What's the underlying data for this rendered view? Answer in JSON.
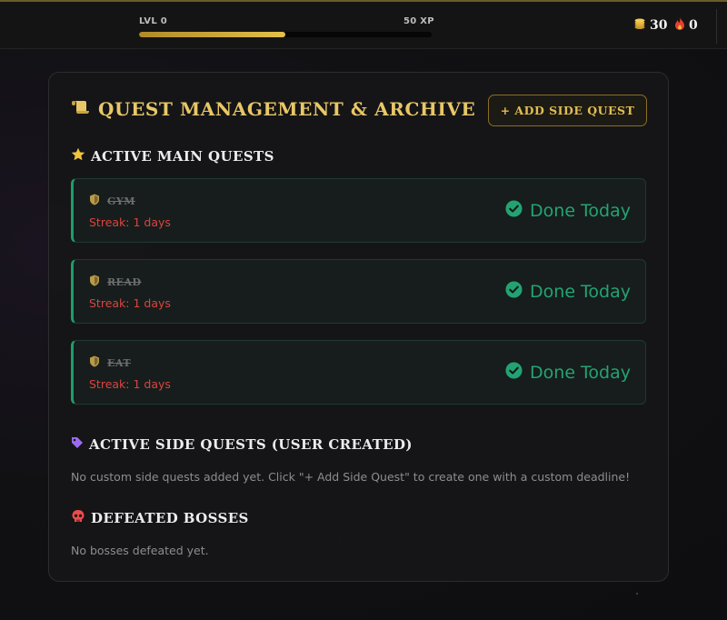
{
  "topbar": {
    "level_label": "LVL 0",
    "xp_label": "50 XP",
    "xp_progress": 0.5,
    "coins": "30",
    "streak": "0",
    "coins_icon": "coins-icon",
    "streak_icon": "fire-icon"
  },
  "panel": {
    "title": "QUEST MANAGEMENT & ARCHIVE",
    "title_icon": "scroll-icon",
    "add_button_label": "+ ADD SIDE QUEST"
  },
  "main_quests": {
    "title": "ACTIVE MAIN QUESTS",
    "title_icon": "star-icon",
    "items": [
      {
        "name": "GYM",
        "streak": "Streak: 1 days",
        "status": "Done Today"
      },
      {
        "name": "READ",
        "streak": "Streak: 1 days",
        "status": "Done Today"
      },
      {
        "name": "EAT",
        "streak": "Streak: 1 days",
        "status": "Done Today"
      }
    ]
  },
  "side_quests": {
    "title": "ACTIVE SIDE QUESTS (USER CREATED)",
    "title_icon": "tag-icon",
    "empty_text": "No custom side quests added yet. Click \"+ Add Side Quest\" to create one with a custom deadline!"
  },
  "bosses": {
    "title": "DEFEATED BOSSES",
    "title_icon": "skull-icon",
    "empty_text": "No bosses defeated yet."
  },
  "colors": {
    "gold": "#e8c766",
    "success": "#23a373",
    "danger": "#d9443f"
  }
}
